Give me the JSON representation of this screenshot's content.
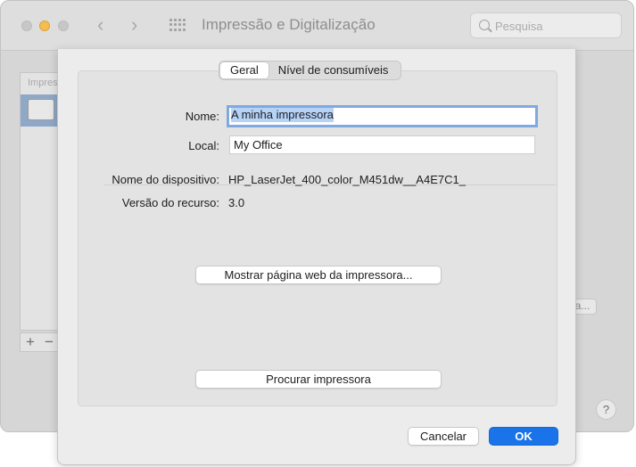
{
  "window": {
    "title": "Impressão e Digitalização",
    "search": {
      "placeholder": "Pesquisa",
      "value": ""
    },
    "list_header": "Impres",
    "add_symbol": "+",
    "remove_symbol": "−",
    "partial_button_label": "a...",
    "help_label": "?",
    "back_symbol": "‹",
    "forward_symbol": "›"
  },
  "tabs": [
    {
      "label": "Geral",
      "selected": true
    },
    {
      "label": "Nível de consumíveis",
      "selected": false
    }
  ],
  "form": {
    "name_label": "Nome:",
    "name_value": "A minha impressora",
    "location_label": "Local:",
    "location_value": "My Office",
    "device_label": "Nome do dispositivo:",
    "device_value": "HP_LaserJet_400_color_M451dw__A4E7C1_",
    "version_label": "Versão do recurso:",
    "version_value": "3.0"
  },
  "buttons": {
    "show_web_page": "Mostrar página web da impressora...",
    "find_printer": "Procurar impressora",
    "cancel": "Cancelar",
    "ok": "OK"
  },
  "colors": {
    "accent": "#1a73e8",
    "selection": "#b5d3f7",
    "focus_ring": "#7fa9e0"
  }
}
